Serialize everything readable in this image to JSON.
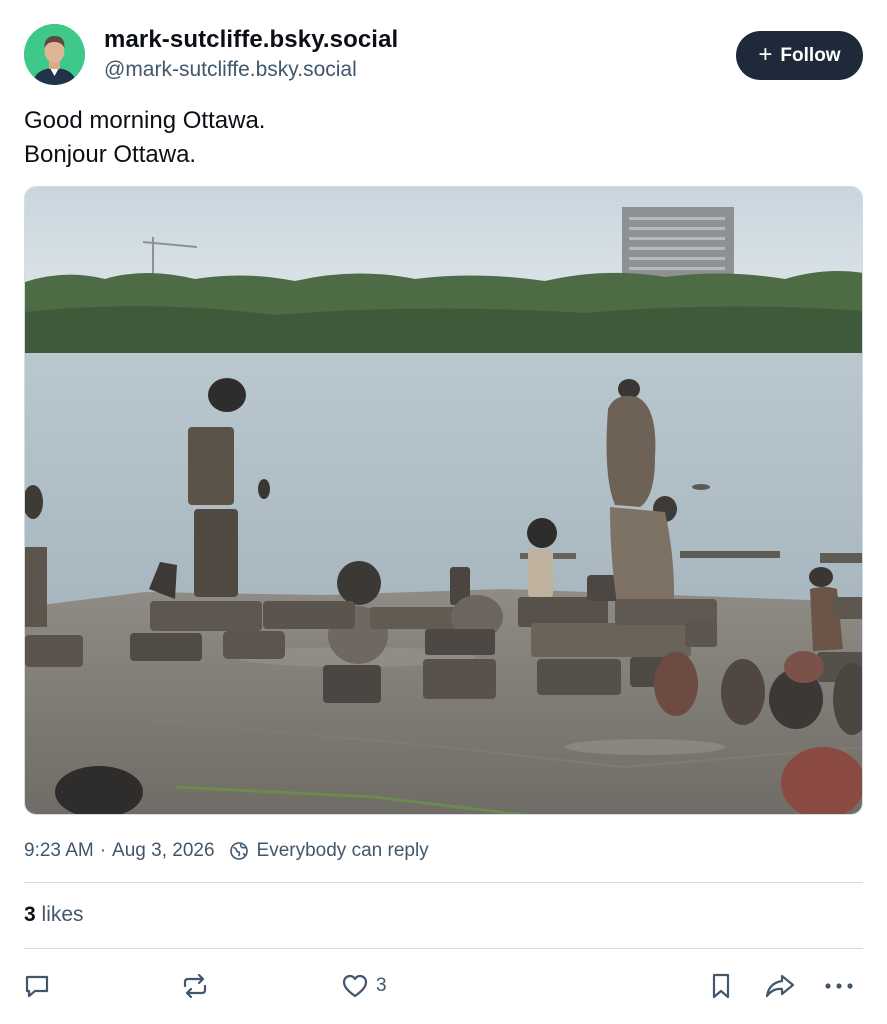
{
  "author": {
    "display_name": "mark-sutcliffe.bsky.social",
    "handle": "@mark-sutcliffe.bsky.social",
    "avatar_bg": "#3ec98a"
  },
  "follow_button": {
    "icon": "plus-icon",
    "label": "Follow"
  },
  "post": {
    "lines": [
      "Good morning Ottawa.",
      "Bonjour Ottawa."
    ],
    "image_description_icon": "photo-balanced-rocks-on-river"
  },
  "meta": {
    "time": "9:23 AM",
    "separator": "·",
    "date": "Aug 3, 2026",
    "reply_setting_icon": "globe-icon",
    "reply_setting": "Everybody can reply"
  },
  "stats": {
    "likes_count": "3",
    "likes_label": "likes"
  },
  "actions": {
    "reply_icon": "reply-icon",
    "repost_icon": "repost-icon",
    "like_icon": "heart-icon",
    "like_count": "3",
    "bookmark_icon": "bookmark-icon",
    "share_icon": "share-icon",
    "more_icon": "more-icon"
  },
  "colors": {
    "text_primary": "#0b0f14",
    "text_secondary": "#42576c",
    "follow_bg": "#1e2a3a",
    "divider": "#d4dbe2"
  }
}
